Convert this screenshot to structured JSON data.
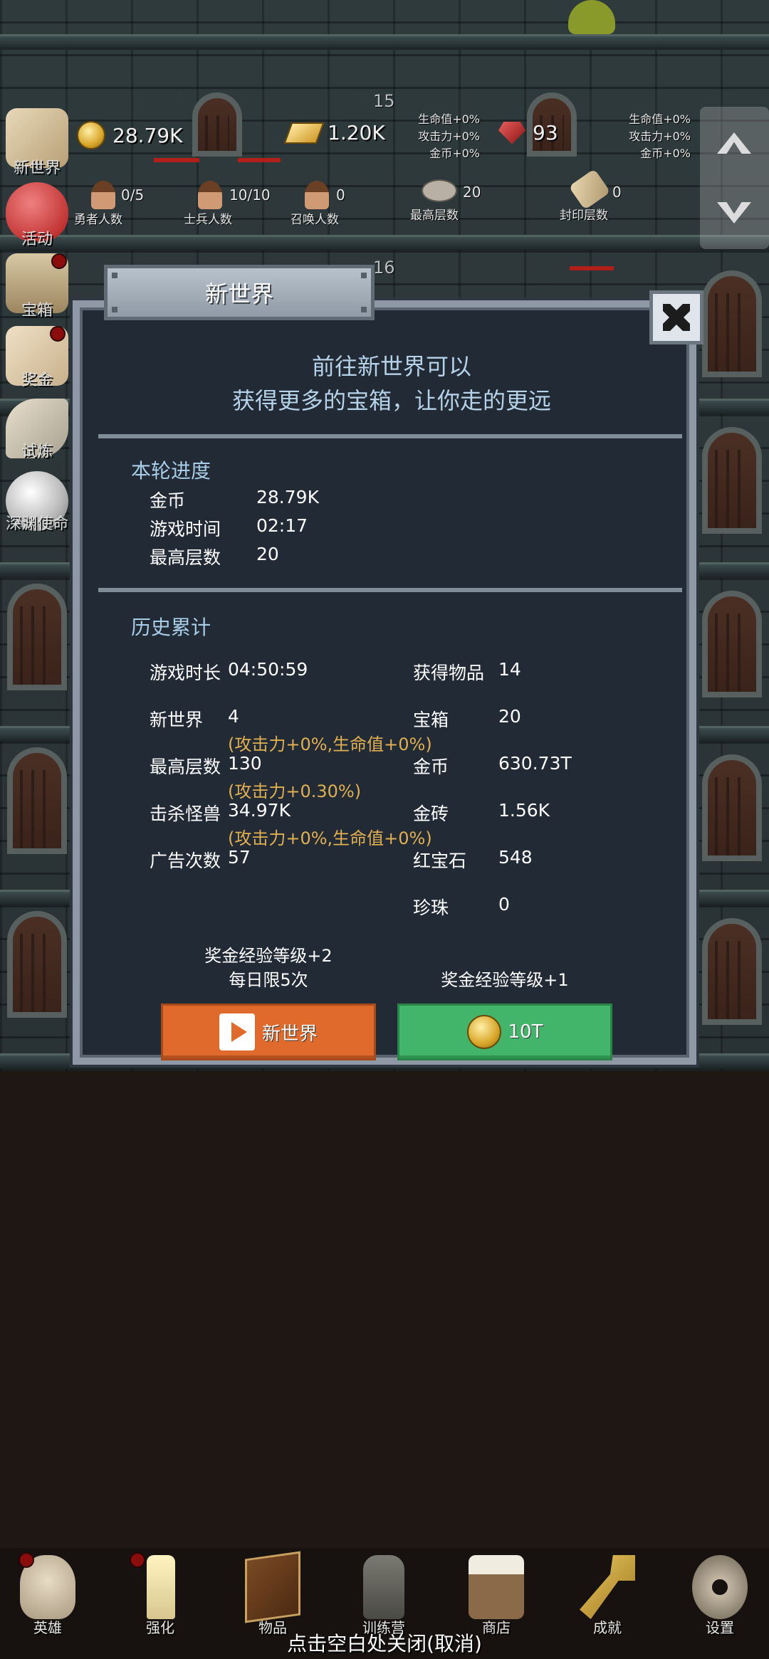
{
  "resources": {
    "gold": "28.79K",
    "gold_bars": "1.20K",
    "rubies": "93",
    "floor_top": "15",
    "floor_mid": "16",
    "bonus_left": [
      "生命值+0%",
      "攻击力+0%",
      "金币+0%"
    ],
    "bonus_right": [
      "生命值+0%",
      "攻击力+0%",
      "金币+0%"
    ]
  },
  "counts": [
    {
      "value": "0/5",
      "label": "勇者人数"
    },
    {
      "value": "10/10",
      "label": "士兵人数"
    },
    {
      "value": "0",
      "label": "召唤人数"
    },
    {
      "value": "20",
      "label": "最高层数"
    },
    {
      "value": "0",
      "label": "封印层数"
    }
  ],
  "side_menu": [
    {
      "label": "新世界",
      "icon": "map-icon"
    },
    {
      "label": "活动",
      "icon": "heart-icon"
    },
    {
      "label": "宝箱",
      "icon": "chest-icon"
    },
    {
      "label": "奖金",
      "icon": "envelope-icon"
    },
    {
      "label": "试炼",
      "icon": "feather-icon"
    },
    {
      "label": "深渊使命",
      "icon": "orb-icon"
    }
  ],
  "dialog": {
    "title": "新世界",
    "intro_line1": "前往新世界可以",
    "intro_line2": "获得更多的宝箱，让你走的更远",
    "round_title": "本轮进度",
    "round": [
      {
        "key": "金币",
        "value": "28.79K"
      },
      {
        "key": "游戏时间",
        "value": "02:17"
      },
      {
        "key": "最高层数",
        "value": "20"
      }
    ],
    "history_title": "历史累计",
    "history_left": [
      {
        "key": "游戏时长",
        "value": "04:50:59",
        "bonus": ""
      },
      {
        "key": "新世界",
        "value": "4",
        "bonus": "(攻击力+0%,生命值+0%)"
      },
      {
        "key": "最高层数",
        "value": "130",
        "bonus": "(攻击力+0.30%)"
      },
      {
        "key": "击杀怪兽",
        "value": "34.97K",
        "bonus": "(攻击力+0%,生命值+0%)"
      },
      {
        "key": "广告次数",
        "value": "57",
        "bonus": ""
      }
    ],
    "history_right": [
      {
        "key": "获得物品",
        "value": "14"
      },
      {
        "key": "宝箱",
        "value": "20"
      },
      {
        "key": "金币",
        "value": "630.73T"
      },
      {
        "key": "金砖",
        "value": "1.56K"
      },
      {
        "key": "红宝石",
        "value": "548"
      },
      {
        "key": "珍珠",
        "value": "0"
      }
    ],
    "btn_left_note1": "奖金经验等级+2",
    "btn_left_note2": "每日限5次",
    "btn_right_note": "奖金经验等级+1",
    "btn_left_label": "新世界",
    "btn_right_label": "10T"
  },
  "bottom_nav": [
    {
      "label": "英雄",
      "icon": "skull-icon"
    },
    {
      "label": "强化",
      "icon": "candle-icon"
    },
    {
      "label": "物品",
      "icon": "book-icon"
    },
    {
      "label": "训练营",
      "icon": "lantern-icon"
    },
    {
      "label": "商店",
      "icon": "mug-icon"
    },
    {
      "label": "成就",
      "icon": "key-icon"
    },
    {
      "label": "设置",
      "icon": "gear-icon"
    }
  ],
  "close_hint": "点击空白处关闭(取消)"
}
